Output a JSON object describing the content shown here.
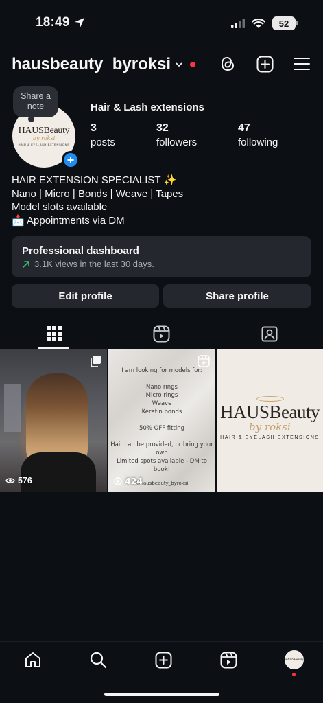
{
  "status": {
    "time": "18:49",
    "battery": "52"
  },
  "profile": {
    "username": "hausbeauty_byroksi",
    "category": "Hair & Lash extensions",
    "note_label": "Share a note",
    "avatar_brand": "HAUSBeauty",
    "avatar_script": "by roksi",
    "avatar_sub": "HAIR & EYELASH EXTENSIONS"
  },
  "stats": [
    {
      "value": "3",
      "label": "posts"
    },
    {
      "value": "32",
      "label": "followers"
    },
    {
      "value": "47",
      "label": "following"
    }
  ],
  "bio": [
    "HAIR EXTENSION SPECIALIST ✨",
    "Nano | Micro | Bonds | Weave | Tapes",
    "Model slots available",
    "📩 Appointments via DM"
  ],
  "dashboard": {
    "title": "Professional dashboard",
    "subtitle": "3.1K views in the last 30 days."
  },
  "buttons": {
    "edit": "Edit profile",
    "share": "Share profile"
  },
  "posts": [
    {
      "views": "576"
    },
    {
      "views": "424",
      "lines_top": [
        "I am looking for models for:"
      ],
      "lines_mid": [
        "Nano rings",
        "Micro rings",
        "Weave",
        "Keratin bonds"
      ],
      "discount": "50% OFF fitting",
      "lines_bottom": [
        "Hair can be provided, or bring your own",
        "Limited spots available - DM to book!"
      ],
      "handle": "@hausbeauty_byroksi"
    },
    {
      "brand": "HAUSBeauty",
      "script": "by roksi",
      "sub": "HAIR & EYELASH EXTENSIONS"
    }
  ],
  "colors": {
    "background": "#0c0f14",
    "card": "#24272d",
    "accent_blue": "#1f8cf4",
    "notification_red": "#ff2f44",
    "trend_green": "#38c172"
  }
}
